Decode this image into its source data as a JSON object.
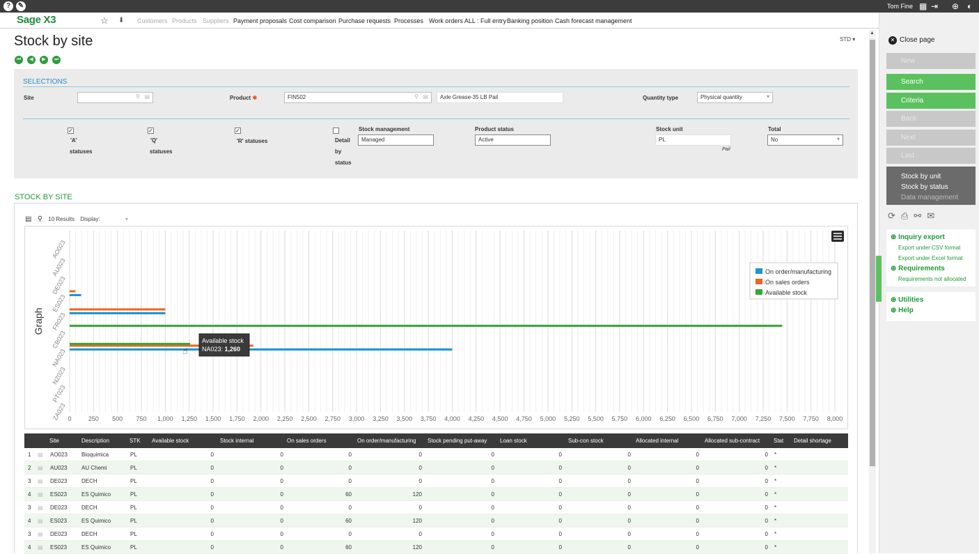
{
  "topbar": {
    "user": "Tom Fine"
  },
  "nav": {
    "logo": "Sage X3",
    "items": [
      "Customers",
      "Products",
      "Suppliers",
      "Payment proposals",
      "Cost comparison",
      "Purchase requests",
      "Processes",
      "Work orders ALL : Full entry",
      "Banking position",
      "Cash forecast management"
    ]
  },
  "page": {
    "title": "Stock by site",
    "std": "STD"
  },
  "selections": {
    "title": "SELECTIONS",
    "site_label": "Site",
    "site_value": "",
    "product_label": "Product",
    "product_value": "FIN502",
    "product_desc": "Axle Grease-35 LB Pail",
    "qtytype_label": "Quantity type",
    "qtytype_value": "Physical quantity",
    "a_line1": "'A'",
    "a_line2": "statuses",
    "q_line1": "'Q'",
    "q_line2": "statuses",
    "r_label": "'R' statuses",
    "detail_l1": "Detail",
    "detail_l2": "by",
    "detail_l3": "status",
    "stockmgmt_label": "Stock management",
    "stockmgmt_value": "Managed",
    "prodstatus_label": "Product status",
    "prodstatus_value": "Active",
    "stockunit_label": "Stock unit",
    "stockunit_value": "PL",
    "stockunit_desc": "Pail",
    "total_label": "Total",
    "total_value": "No"
  },
  "grid": {
    "title": "STOCK BY SITE",
    "results": "10 Results",
    "display": "Display:"
  },
  "chart_data": {
    "type": "bar",
    "orientation": "horizontal",
    "ylabel": "Graph",
    "categories": [
      "AO023",
      "AU023",
      "DE023",
      "ES023",
      "FR023",
      "CB023",
      "NA023",
      "NZ023",
      "PT023",
      "ZA023"
    ],
    "xticks": [
      "0",
      "250",
      "500",
      "750",
      "1,000",
      "1,250",
      "1,500",
      "1,750",
      "2,000",
      "2,250",
      "2,500",
      "2,750",
      "3,000",
      "3,250",
      "3,500",
      "3,750",
      "4,000",
      "4,250",
      "4,500",
      "4,750",
      "5,000",
      "5,250",
      "5,500",
      "5,750",
      "6,000",
      "6,250",
      "6,500",
      "6,750",
      "7,000",
      "7,250",
      "7,500",
      "7,750",
      "8,000"
    ],
    "xlim": [
      0,
      8000
    ],
    "series": [
      {
        "name": "On order/manufacturing",
        "color": "#1e94d2",
        "values": [
          0,
          0,
          0,
          120,
          1000,
          0,
          4000,
          0,
          0,
          0
        ]
      },
      {
        "name": "On sales orders",
        "color": "#f0641e",
        "values": [
          0,
          0,
          0,
          60,
          1000,
          0,
          1920,
          0,
          0,
          0
        ]
      },
      {
        "name": "Available stock",
        "color": "#3aa63a",
        "values": [
          0,
          0,
          0,
          0,
          0,
          7450,
          1260,
          0,
          0,
          0
        ]
      }
    ],
    "tooltip": {
      "title": "Available stock",
      "label": "NA023:",
      "value": "1,260"
    }
  },
  "table": {
    "headers": [
      "Site",
      "Description",
      "STK",
      "Available stock",
      "Stock internal",
      "On sales orders",
      "On order/manufacturing",
      "Stock pending put-away",
      "Loan stock",
      "Sub-con stock",
      "Allocated internal",
      "Allocated sub-contract",
      "Stat",
      "Detail shortage"
    ],
    "rows": [
      {
        "n": "1",
        "site": "AO023",
        "desc": "Bioquimica",
        "stk": "PL",
        "v": [
          "0",
          "0",
          "0",
          "0",
          "0",
          "0",
          "0",
          "0",
          "0"
        ],
        "stat": "*"
      },
      {
        "n": "2",
        "site": "AU023",
        "desc": "AU Chemi",
        "stk": "PL",
        "v": [
          "0",
          "0",
          "0",
          "0",
          "0",
          "0",
          "0",
          "0",
          "0"
        ],
        "stat": "*"
      },
      {
        "n": "3",
        "site": "DE023",
        "desc": "DECH",
        "stk": "PL",
        "v": [
          "0",
          "0",
          "0",
          "0",
          "0",
          "0",
          "0",
          "0",
          "0"
        ],
        "stat": "*"
      },
      {
        "n": "4",
        "site": "ES023",
        "desc": "ES Quimico",
        "stk": "PL",
        "v": [
          "0",
          "0",
          "60",
          "120",
          "0",
          "0",
          "0",
          "0",
          "0"
        ],
        "stat": "*"
      },
      {
        "n": "3",
        "site": "DE023",
        "desc": "DECH",
        "stk": "PL",
        "v": [
          "0",
          "0",
          "0",
          "0",
          "0",
          "0",
          "0",
          "0",
          "0"
        ],
        "stat": "*"
      },
      {
        "n": "4",
        "site": "ES023",
        "desc": "ES Quimico",
        "stk": "PL",
        "v": [
          "0",
          "0",
          "60",
          "120",
          "0",
          "0",
          "0",
          "0",
          "0"
        ],
        "stat": "*"
      },
      {
        "n": "3",
        "site": "DE023",
        "desc": "DECH",
        "stk": "PL",
        "v": [
          "0",
          "0",
          "0",
          "0",
          "0",
          "0",
          "0",
          "0",
          "0"
        ],
        "stat": "*"
      },
      {
        "n": "4",
        "site": "ES023",
        "desc": "ES Quimico",
        "stk": "PL",
        "v": [
          "0",
          "0",
          "60",
          "120",
          "0",
          "0",
          "0",
          "0",
          "0"
        ],
        "stat": "*"
      }
    ]
  },
  "right": {
    "close": "Close page",
    "buttons": [
      "New",
      "Search",
      "Criteria",
      "Back",
      "Next",
      "Last"
    ],
    "links": [
      "Stock by unit",
      "Stock by status",
      "Data management"
    ],
    "inquiry": "Inquiry export",
    "csv": "Export under CSV format",
    "excel": "Export under Excel format",
    "requirements": "Requirements",
    "req_sub": "Requirements not allocated",
    "utilities": "Utilities",
    "help": "Help"
  }
}
